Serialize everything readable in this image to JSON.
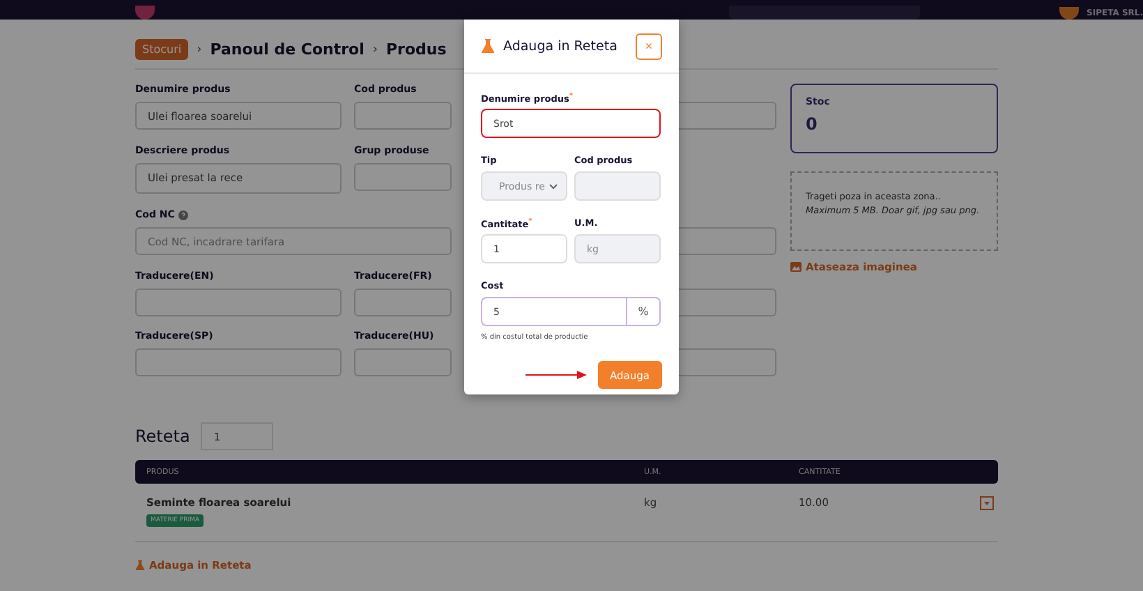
{
  "top_bar": {
    "company": "SIPETA SRL."
  },
  "breadcrumb": [
    {
      "label": "Stocuri",
      "kind": "badge"
    },
    {
      "label": "›",
      "kind": "separator"
    },
    {
      "label": "Panoul de Control",
      "kind": "text"
    },
    {
      "label": "›",
      "kind": "separator"
    },
    {
      "label": "Produs",
      "kind": "text"
    }
  ],
  "form_rows": [
    {
      "fields": [
        {
          "label": "Denumire produs",
          "value": "Ulei floarea soarelui",
          "kind": "input"
        },
        {
          "label": "Cod produs",
          "kind": "input"
        },
        {
          "kind": "select"
        }
      ]
    },
    {
      "fields": [
        {
          "label": "Descriere produs",
          "value": "Ulei presat la rece",
          "kind": "textarea"
        },
        {
          "label": "Grup produse",
          "kind": "input"
        }
      ]
    },
    {
      "fields": [
        {
          "label": "Cod NC",
          "placeholder": "Cod NC, incadrare tarifara",
          "kind": "wide",
          "help": true
        },
        {
          "kind": "input"
        }
      ]
    },
    {
      "fields": [
        {
          "label": "Traducere(EN)",
          "kind": "input"
        },
        {
          "label": "Traducere(FR)",
          "kind": "input"
        },
        {
          "kind": "input"
        }
      ]
    },
    {
      "fields": [
        {
          "label": "Traducere(SP)",
          "kind": "input"
        },
        {
          "label": "Traducere(HU)",
          "kind": "input"
        },
        {
          "kind": "input"
        }
      ]
    }
  ],
  "stock": {
    "label": "Stoc",
    "value": "0"
  },
  "dropzone": {
    "text": "Trageti poza in aceasta zona..",
    "hint": "Maximum 5 MB. Doar gif, jpg sau png."
  },
  "attach_link": "Ataseaza imaginea",
  "recipe": {
    "title": "Reteta",
    "quantity": "1",
    "columns": [
      "PRODUS",
      "U.M.",
      "CANTITATE"
    ],
    "rows": [
      {
        "product": "Seminte floarea soarelui",
        "tag": "MATERIE PRIMA",
        "unit": "kg",
        "quantity": "10.00"
      }
    ],
    "add_link": "Adauga in Reteta"
  },
  "modal": {
    "title": "Adauga in Reteta",
    "close": "×",
    "required_mark": "*",
    "fields": [
      {
        "label": "Denumire produs",
        "required": true,
        "value": "Srot",
        "kind": "input",
        "disabled": false,
        "invalid": true
      },
      {
        "label": "Tip",
        "required": false,
        "value": "Produs re",
        "kind": "select",
        "disabled": true,
        "invalid": false
      },
      {
        "label": "Cod produs",
        "required": false,
        "kind": "input",
        "disabled": true,
        "invalid": false
      },
      {
        "label": "Cantitate",
        "required": true,
        "value": "1",
        "kind": "input",
        "disabled": false,
        "invalid": false
      },
      {
        "label": "U.M.",
        "required": false,
        "value": "kg",
        "kind": "input",
        "disabled": true,
        "invalid": false
      },
      {
        "label": "Cost",
        "required": false,
        "value": "5",
        "addon": "%",
        "kind": "group",
        "disabled": false,
        "invalid": false,
        "help": "% din costul total de productie"
      }
    ],
    "submit": "Adauga"
  }
}
